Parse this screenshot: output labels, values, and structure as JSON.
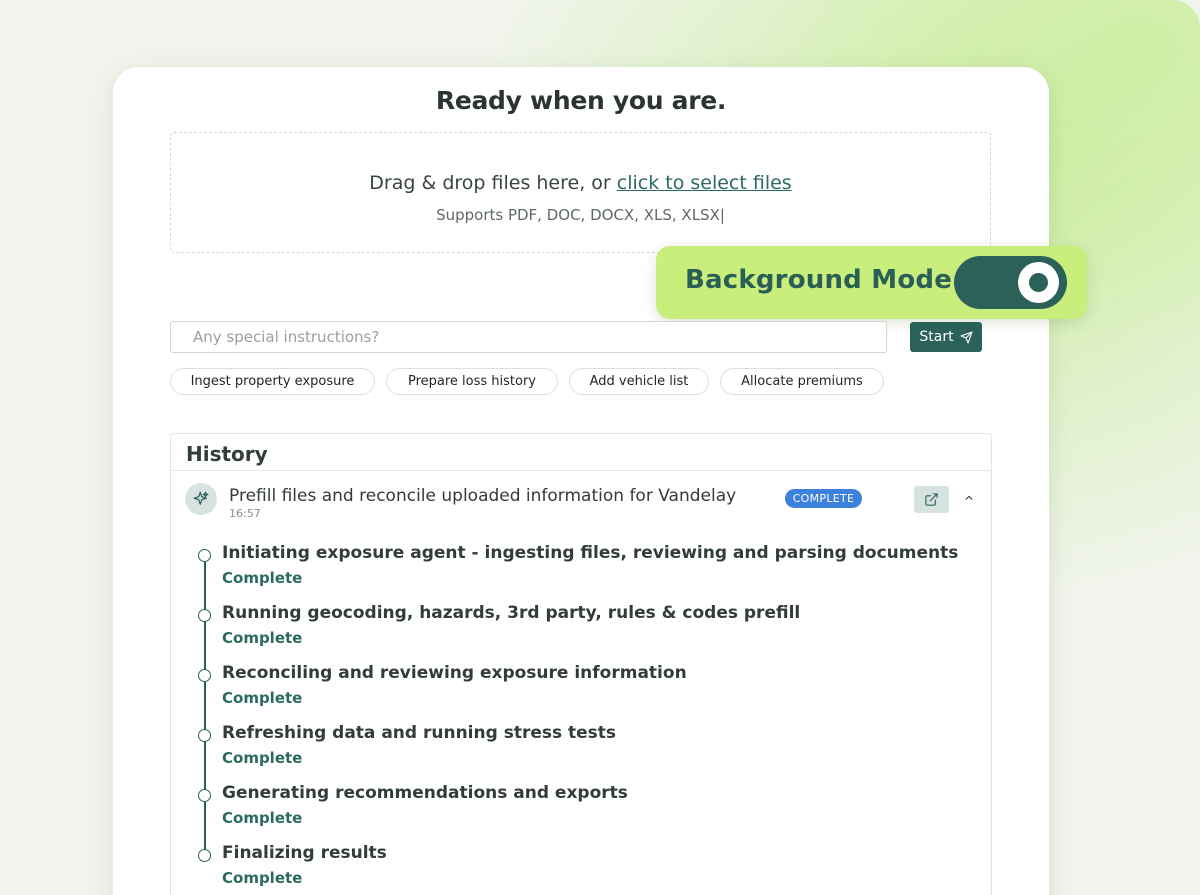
{
  "title": "Ready when you are.",
  "dropzone": {
    "text_prefix": "Drag & drop files here, or ",
    "link_text": "click to select files",
    "supported": "Supports PDF, DOC, DOCX, XLS, XLSX|"
  },
  "background_mode": {
    "label": "Background Mode",
    "enabled": true
  },
  "instructions": {
    "placeholder": "Any special instructions?",
    "value": ""
  },
  "start_button": {
    "label": "Start",
    "icon": "send-icon"
  },
  "chips": [
    {
      "label": "Ingest property exposure"
    },
    {
      "label": "Prepare loss history"
    },
    {
      "label": "Add vehicle list"
    },
    {
      "label": "Allocate premiums"
    }
  ],
  "history": {
    "title": "History",
    "run": {
      "icon": "sparkle-icon",
      "title": "Prefill files and reconcile uploaded information for Vandelay",
      "time": "16:57",
      "status": "COMPLETE",
      "status_color": "#3c82dc"
    },
    "steps": [
      {
        "title": "Initiating exposure agent - ingesting files, reviewing and parsing documents",
        "status": "Complete"
      },
      {
        "title": "Running geocoding, hazards, 3rd party, rules & codes prefill",
        "status": "Complete"
      },
      {
        "title": "Reconciling and reviewing exposure information",
        "status": "Complete"
      },
      {
        "title": "Refreshing data and running stress tests",
        "status": "Complete"
      },
      {
        "title": "Generating recommendations and exports",
        "status": "Complete"
      },
      {
        "title": "Finalizing results",
        "status": "Complete"
      }
    ]
  },
  "colors": {
    "accent": "#2b6158",
    "highlight": "#c8ee7c",
    "badge": "#3c82dc"
  }
}
